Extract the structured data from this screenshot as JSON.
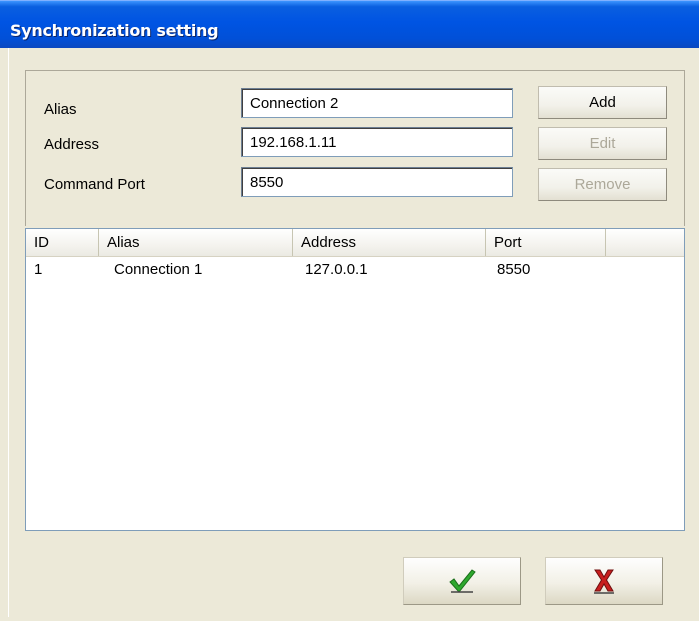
{
  "window": {
    "title": "Synchronization setting"
  },
  "form": {
    "alias_label": "Alias",
    "alias_value": "Connection 2",
    "address_label": "Address",
    "address_value": "192.168.1.11",
    "port_label": "Command Port",
    "port_value": "8550"
  },
  "buttons": {
    "add_label": "Add",
    "edit_label": "Edit",
    "remove_label": "Remove"
  },
  "table": {
    "columns": [
      "ID",
      "Alias",
      "Address",
      "Port"
    ],
    "rows": [
      [
        "1",
        "Connection 1",
        "127.0.0.1",
        "8550"
      ]
    ]
  },
  "icons": {
    "ok": "checkmark-icon",
    "cancel": "cross-icon"
  },
  "colors": {
    "title_bar": "#0054e3",
    "ok_icon": "#2ea82e",
    "cancel_icon": "#c81e1e"
  }
}
